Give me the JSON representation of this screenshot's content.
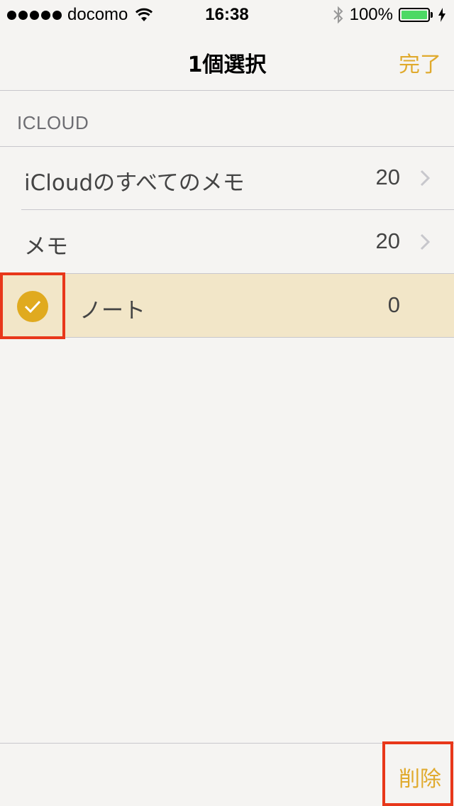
{
  "status": {
    "carrier": "docomo",
    "time": "16:38",
    "battery": "100%"
  },
  "nav": {
    "title": "1個選択",
    "done_label": "完了"
  },
  "section": {
    "header": "ICLOUD"
  },
  "folders": [
    {
      "label": "iCloudのすべてのメモ",
      "count": "20"
    },
    {
      "label": "メモ",
      "count": "20"
    },
    {
      "label": "ノート",
      "count": "0",
      "selected": true
    }
  ],
  "toolbar": {
    "delete_label": "削除"
  },
  "colors": {
    "accent": "#e0aa2d",
    "selected_row": "#f2e6c8",
    "highlight": "#e8371a",
    "battery": "#4cd964"
  }
}
